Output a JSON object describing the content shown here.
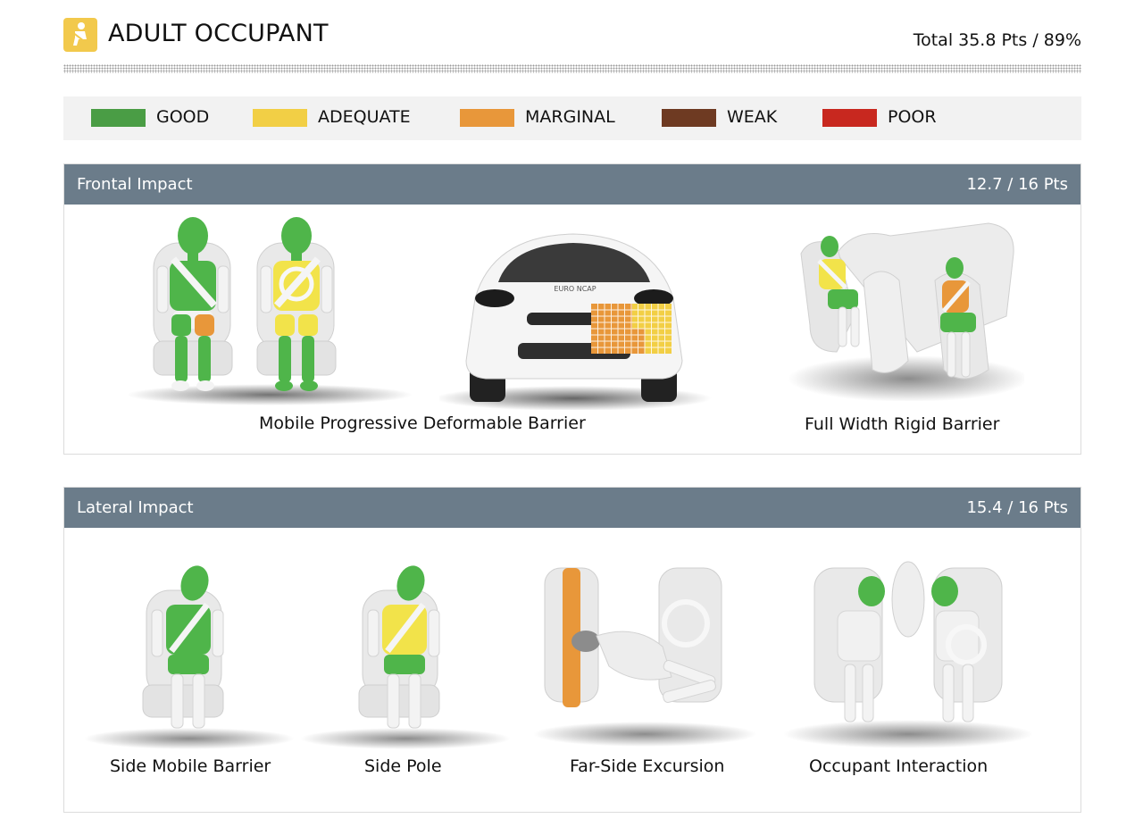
{
  "header": {
    "title": "ADULT OCCUPANT",
    "total": "Total 35.8 Pts / 89%",
    "badge_color": "#f2c94c",
    "icon": "seated-occupant-icon"
  },
  "legend": [
    {
      "label": "GOOD",
      "color": "#4a9d45"
    },
    {
      "label": "ADEQUATE",
      "color": "#f2cf45"
    },
    {
      "label": "MARGINAL",
      "color": "#e8973a"
    },
    {
      "label": "WEAK",
      "color": "#6e3a22"
    },
    {
      "label": "POOR",
      "color": "#c8281f"
    }
  ],
  "frontal": {
    "name": "Frontal Impact",
    "points": "12.7 / 16 Pts",
    "captions": {
      "mpdb": "Mobile Progressive Deformable Barrier",
      "fwrb": "Full Width Rigid Barrier"
    },
    "car_logo": "EURO NCAP"
  },
  "lateral": {
    "name": "Lateral Impact",
    "points": "15.4 / 16 Pts",
    "captions": {
      "smb": "Side Mobile Barrier",
      "pole": "Side Pole",
      "far_side": "Far-Side Excursion",
      "interaction": "Occupant Interaction"
    }
  },
  "colors": {
    "header_bar": "#6b7c8a",
    "seat": "#e9e9e9",
    "dummy": "#f3f3f3"
  }
}
